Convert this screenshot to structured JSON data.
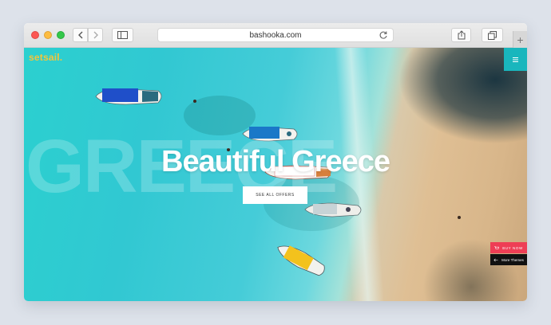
{
  "browser": {
    "url": "bashooka.com",
    "back_icon": "chevron-left-icon",
    "forward_icon": "chevron-right-icon",
    "sidebar_icon": "sidebar-icon",
    "reload_icon": "reload-icon",
    "share_icon": "share-icon",
    "tabs_icon": "tabs-icon",
    "new_tab_label": "+"
  },
  "site": {
    "logo": "setsail.",
    "menu_icon": "hamburger-icon",
    "background_word": "GREECE",
    "hero_title": "Beautiful Greece",
    "cta_label": "SEE ALL OFFERS",
    "buy_now_label": "BUY NOW",
    "more_themes_label": "More Themes",
    "colors": {
      "accent": "#19b6bd",
      "logo": "#f6c53a",
      "buy_now": "#ee3e55"
    }
  }
}
